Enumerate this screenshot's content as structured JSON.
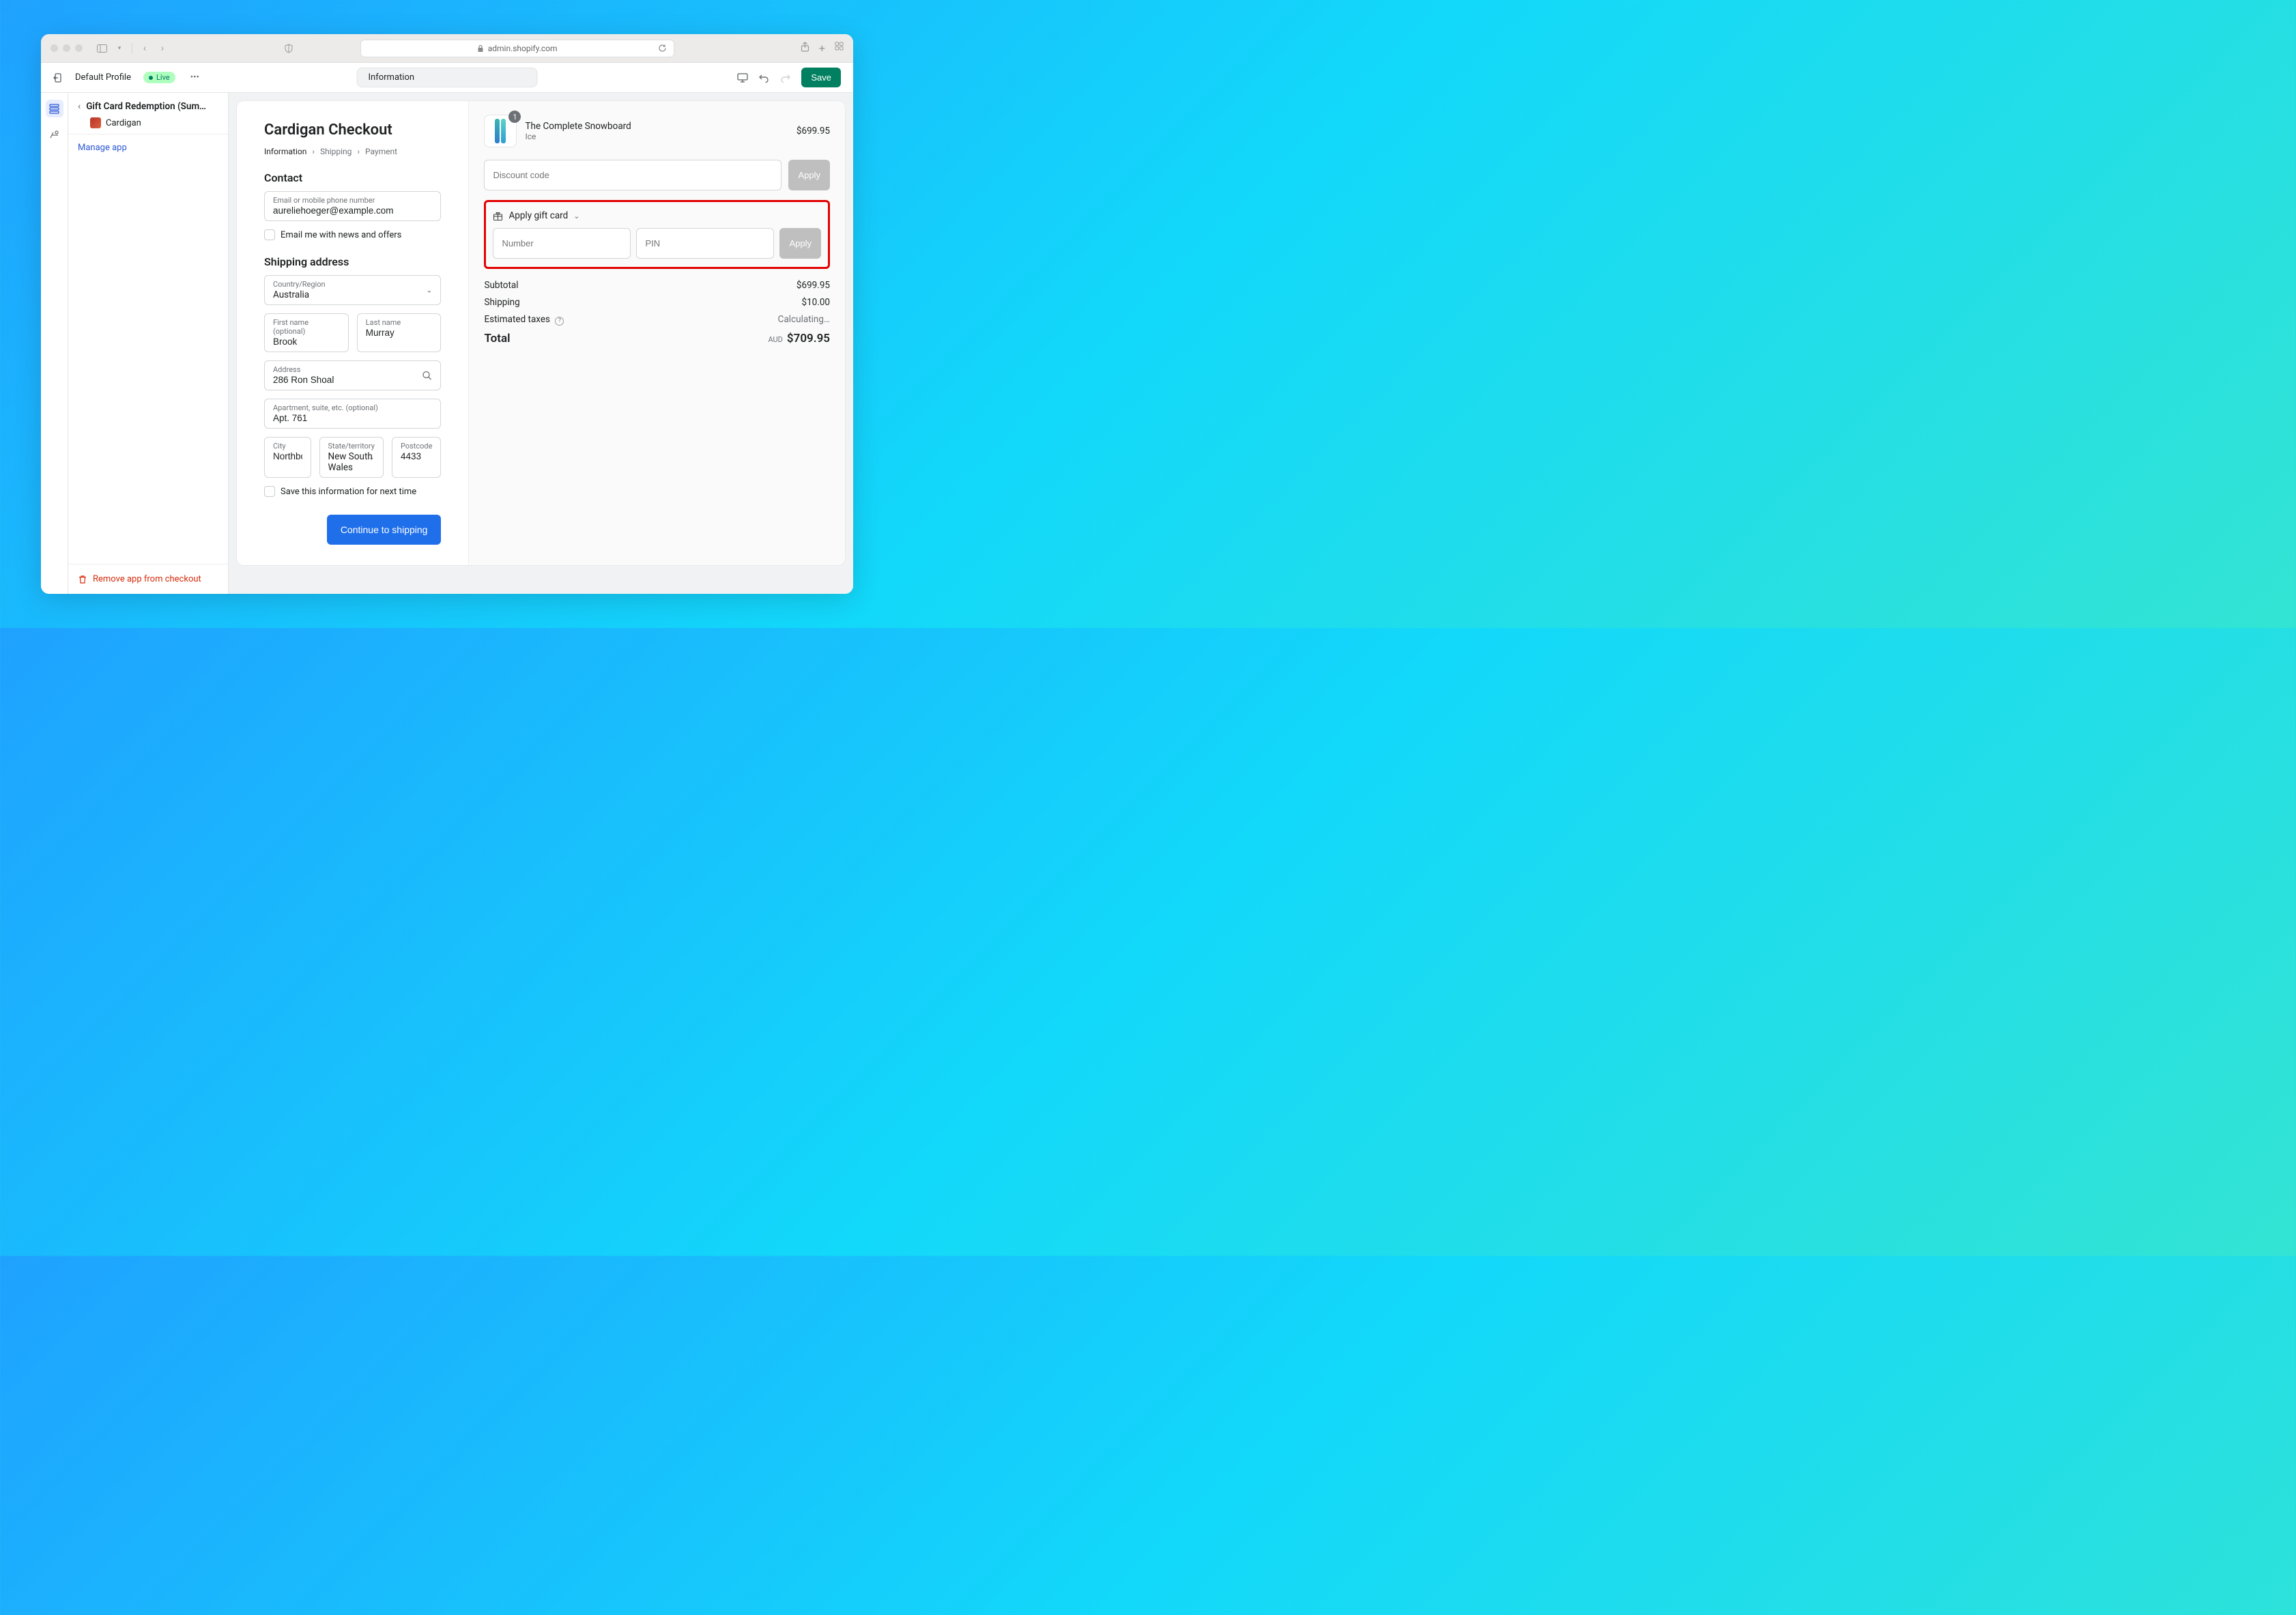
{
  "browser": {
    "url": "admin.shopify.com"
  },
  "topbar": {
    "profile": "Default Profile",
    "live": "Live",
    "tab": "Information",
    "save": "Save"
  },
  "sidebar": {
    "title": "Gift Card Redemption (Sum…",
    "app_name": "Cardigan",
    "manage_link": "Manage app",
    "remove_link": "Remove app from checkout"
  },
  "checkout": {
    "title": "Cardigan Checkout",
    "breadcrumb": {
      "a": "Information",
      "b": "Shipping",
      "c": "Payment"
    },
    "contact_h": "Contact",
    "email": {
      "label": "Email or mobile phone number",
      "value": "aureliehoeger@example.com"
    },
    "news_optin": "Email me with news and offers",
    "ship_h": "Shipping address",
    "country": {
      "label": "Country/Region",
      "value": "Australia"
    },
    "first": {
      "label": "First name (optional)",
      "value": "Brook"
    },
    "last": {
      "label": "Last name",
      "value": "Murray"
    },
    "address": {
      "label": "Address",
      "value": "286 Ron Shoal"
    },
    "apt": {
      "label": "Apartment, suite, etc. (optional)",
      "value": "Apt. 761"
    },
    "city": {
      "label": "City",
      "value": "Northborough"
    },
    "state": {
      "label": "State/territory",
      "value": "New South Wales"
    },
    "postcode": {
      "label": "Postcode",
      "value": "4433"
    },
    "save_info": "Save this information for next time",
    "cta": "Continue to shipping"
  },
  "cart": {
    "item": {
      "name": "The Complete Snowboard",
      "variant": "Ice",
      "qty": "1",
      "price": "$699.95"
    },
    "discount": {
      "placeholder": "Discount code",
      "apply": "Apply"
    },
    "gift": {
      "heading": "Apply gift card",
      "number": "Number",
      "pin": "PIN",
      "apply": "Apply"
    },
    "subtotal": {
      "label": "Subtotal",
      "value": "$699.95"
    },
    "shipping": {
      "label": "Shipping",
      "value": "$10.00"
    },
    "tax": {
      "label": "Estimated taxes",
      "value": "Calculating…"
    },
    "total": {
      "label": "Total",
      "currency": "AUD",
      "value": "$709.95"
    }
  }
}
